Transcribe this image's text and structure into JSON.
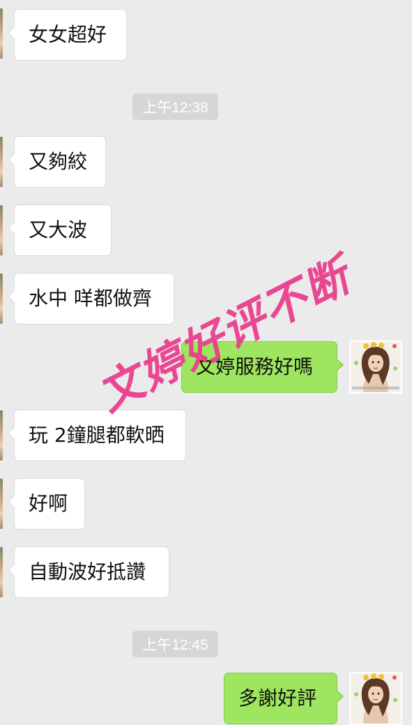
{
  "messages": [
    {
      "side": "in",
      "text": "女女超好"
    },
    {
      "side": "time",
      "text": "上午12:38"
    },
    {
      "side": "in",
      "text": "又夠絞"
    },
    {
      "side": "in",
      "text": "又大波"
    },
    {
      "side": "in",
      "text": "水中 咩都做齊"
    },
    {
      "side": "out",
      "text": "文婷服務好嗎"
    },
    {
      "side": "in",
      "text": "玩 2鐘腿都軟晒"
    },
    {
      "side": "in",
      "text": "好啊"
    },
    {
      "side": "in",
      "text": "自動波好抵讚"
    },
    {
      "side": "time",
      "text": "上午12:45"
    },
    {
      "side": "out",
      "text": "多謝好評"
    }
  ],
  "watermark": {
    "text": "文婷好评不断",
    "color": "#ea3f8e"
  },
  "colors": {
    "background": "#ebebeb",
    "incoming_bubble": "#ffffff",
    "outgoing_bubble": "#9ee65f",
    "timestamp_bg": "#d6d6d6"
  },
  "avatar": {
    "icon": "user-avatar-photo"
  }
}
